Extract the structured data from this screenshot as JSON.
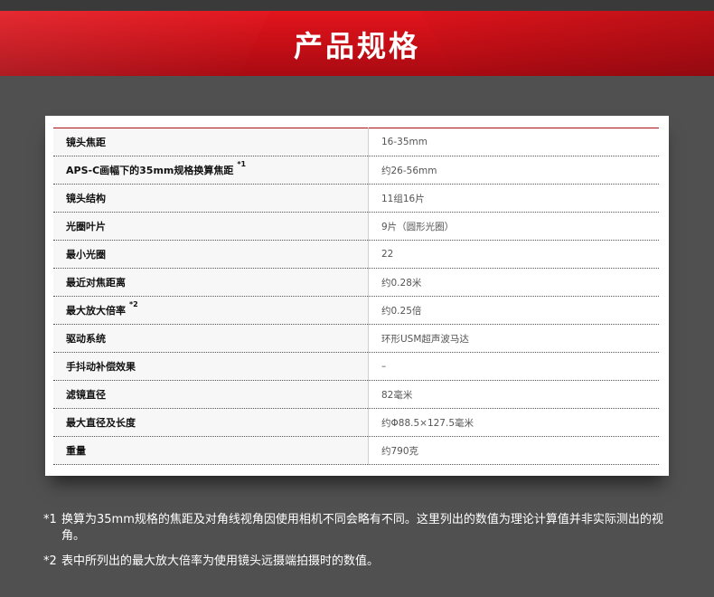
{
  "header": {
    "title": "产品规格"
  },
  "specs": [
    {
      "label": "镜头焦距",
      "note": "",
      "value": "16-35mm"
    },
    {
      "label": "APS-C画幅下的35mm规格换算焦距",
      "note": "*1",
      "value": "约26-56mm"
    },
    {
      "label": "镜头结构",
      "note": "",
      "value": "11组16片"
    },
    {
      "label": "光圈叶片",
      "note": "",
      "value": "9片（圆形光圈）"
    },
    {
      "label": "最小光圈",
      "note": "",
      "value": "22"
    },
    {
      "label": "最近对焦距离",
      "note": "",
      "value": "约0.28米"
    },
    {
      "label": "最大放大倍率",
      "note": "*2",
      "value": "约0.25倍"
    },
    {
      "label": "驱动系统",
      "note": "",
      "value": "环形USM超声波马达"
    },
    {
      "label": "手抖动补偿效果",
      "note": "",
      "value": "–"
    },
    {
      "label": "滤镜直径",
      "note": "",
      "value": "82毫米"
    },
    {
      "label": "最大直径及长度",
      "note": "",
      "value": "约Φ88.5×127.5毫米"
    },
    {
      "label": "重量",
      "note": "",
      "value": "约790克"
    }
  ],
  "footnotes": [
    {
      "mark": "*1",
      "text": "换算为35mm规格的焦距及对角线视角因使用相机不同会略有不同。这里列出的数值为理论计算值并非实际测出的视角。"
    },
    {
      "mark": "*2",
      "text": "表中所列出的最大放大倍率为使用镜头远摄端拍摄时的数值。"
    }
  ]
}
